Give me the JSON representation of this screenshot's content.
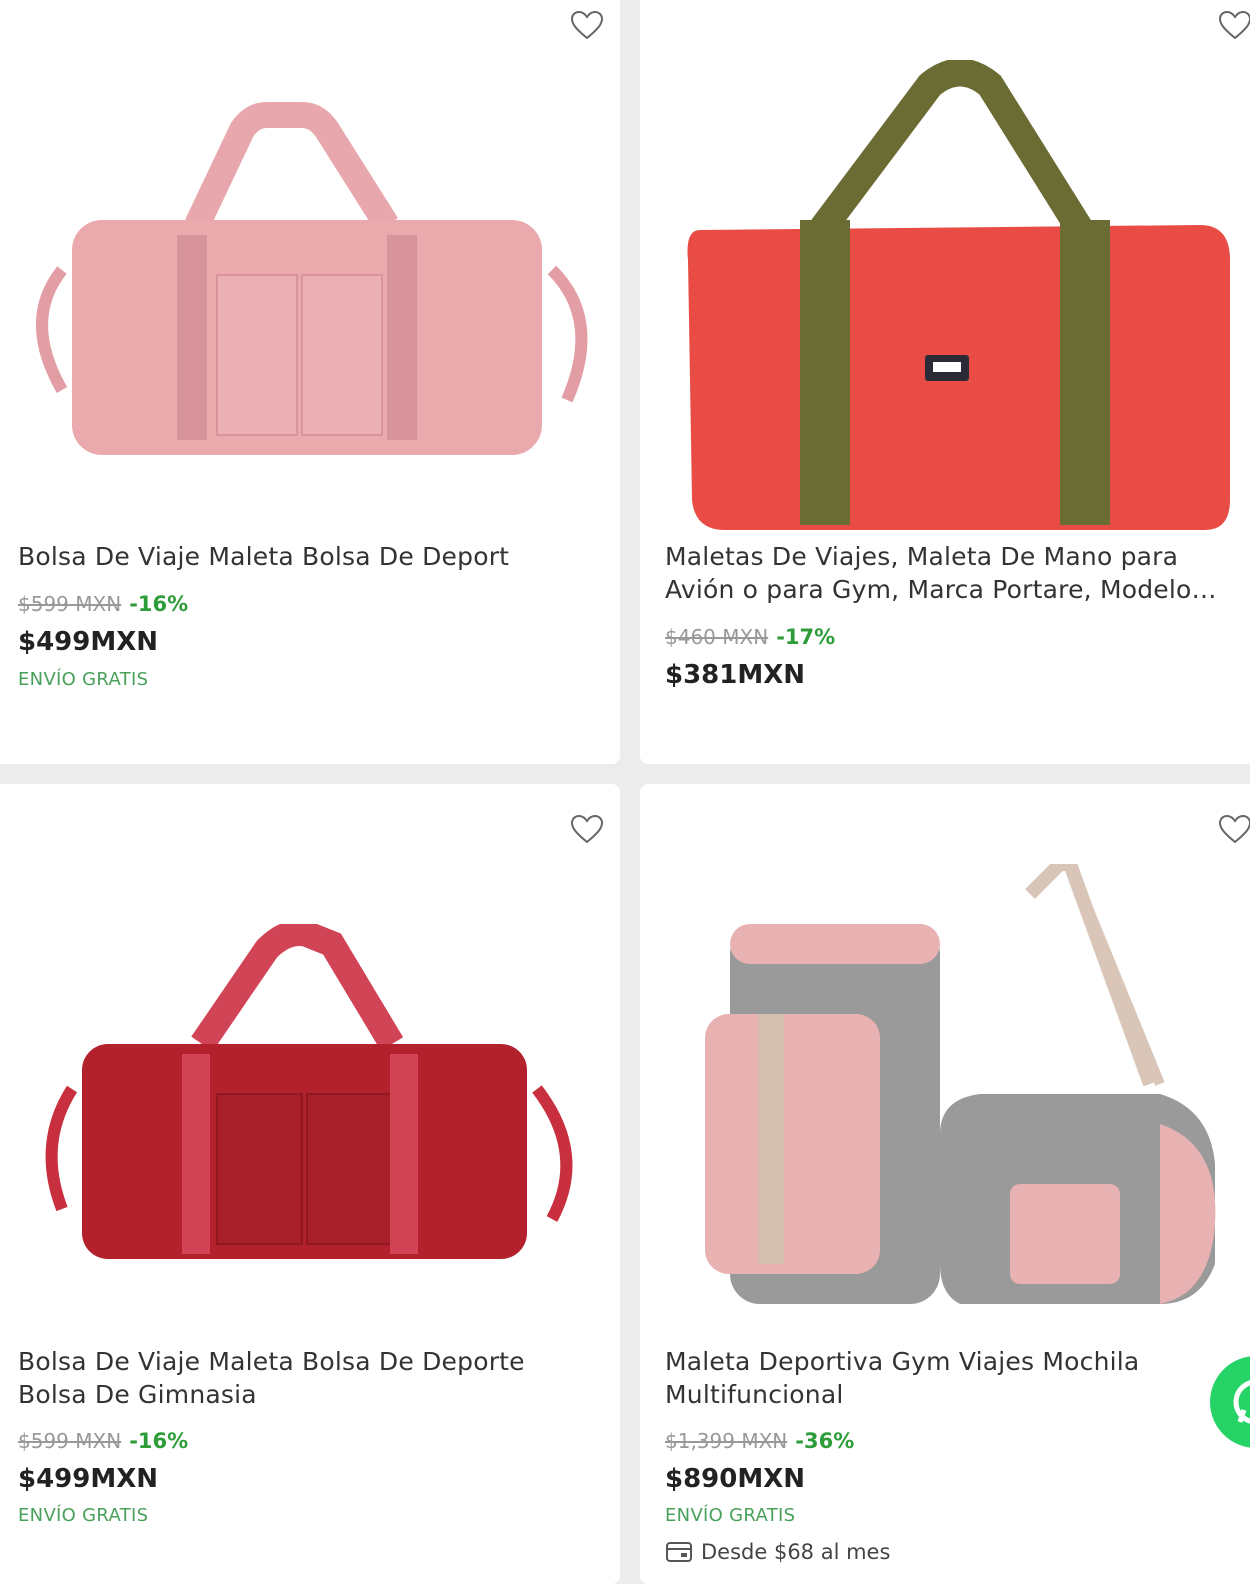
{
  "products": [
    {
      "title": "Bolsa De Viaje Maleta Bolsa De Deport",
      "old_price": "$599 MXN",
      "discount": "-16%",
      "price": "$499MXN",
      "shipping": "ENVÍO GRATIS",
      "image_desc": "pink duffel bag",
      "colors": {
        "body": "#eaa9ac",
        "strap": "#e39ea5"
      }
    },
    {
      "title": "Maletas De Viajes, Maleta De Mano para Avión o para Gym, Marca Portare, Modelo…",
      "old_price": "$460 MXN",
      "discount": "-17%",
      "price": "$381MXN",
      "shipping": "",
      "image_desc": "red duffel bag with olive straps",
      "colors": {
        "body": "#e84c44",
        "strap": "#6b6b34"
      }
    },
    {
      "title": "Bolsa De Viaje Maleta Bolsa De Deporte Bolsa De Gimnasia",
      "old_price": "$599 MXN",
      "discount": "-16%",
      "price": "$499MXN",
      "shipping": "ENVÍO GRATIS",
      "image_desc": "dark red duffel bag",
      "colors": {
        "body": "#b3222c",
        "strap": "#d14456"
      }
    },
    {
      "title": "Maleta Deportiva Gym Viajes Mochila Multifuncional",
      "old_price": "$1,399 MXN",
      "discount": "-36%",
      "price": "$890MXN",
      "shipping": "ENVÍO GRATIS",
      "installments": "Desde $68 al mes",
      "image_desc": "pink and grey backpack and duffel",
      "colors": {
        "body": "#e8b1b2",
        "accent": "#9a9a9a"
      }
    }
  ],
  "icons": {
    "favorite": "heart-outline-icon",
    "installments": "credit-card-icon",
    "chat": "whatsapp-icon"
  },
  "colors": {
    "discount_green": "#2f9c3a",
    "shipping_green": "#49a05a",
    "whatsapp_green": "#25d366"
  }
}
